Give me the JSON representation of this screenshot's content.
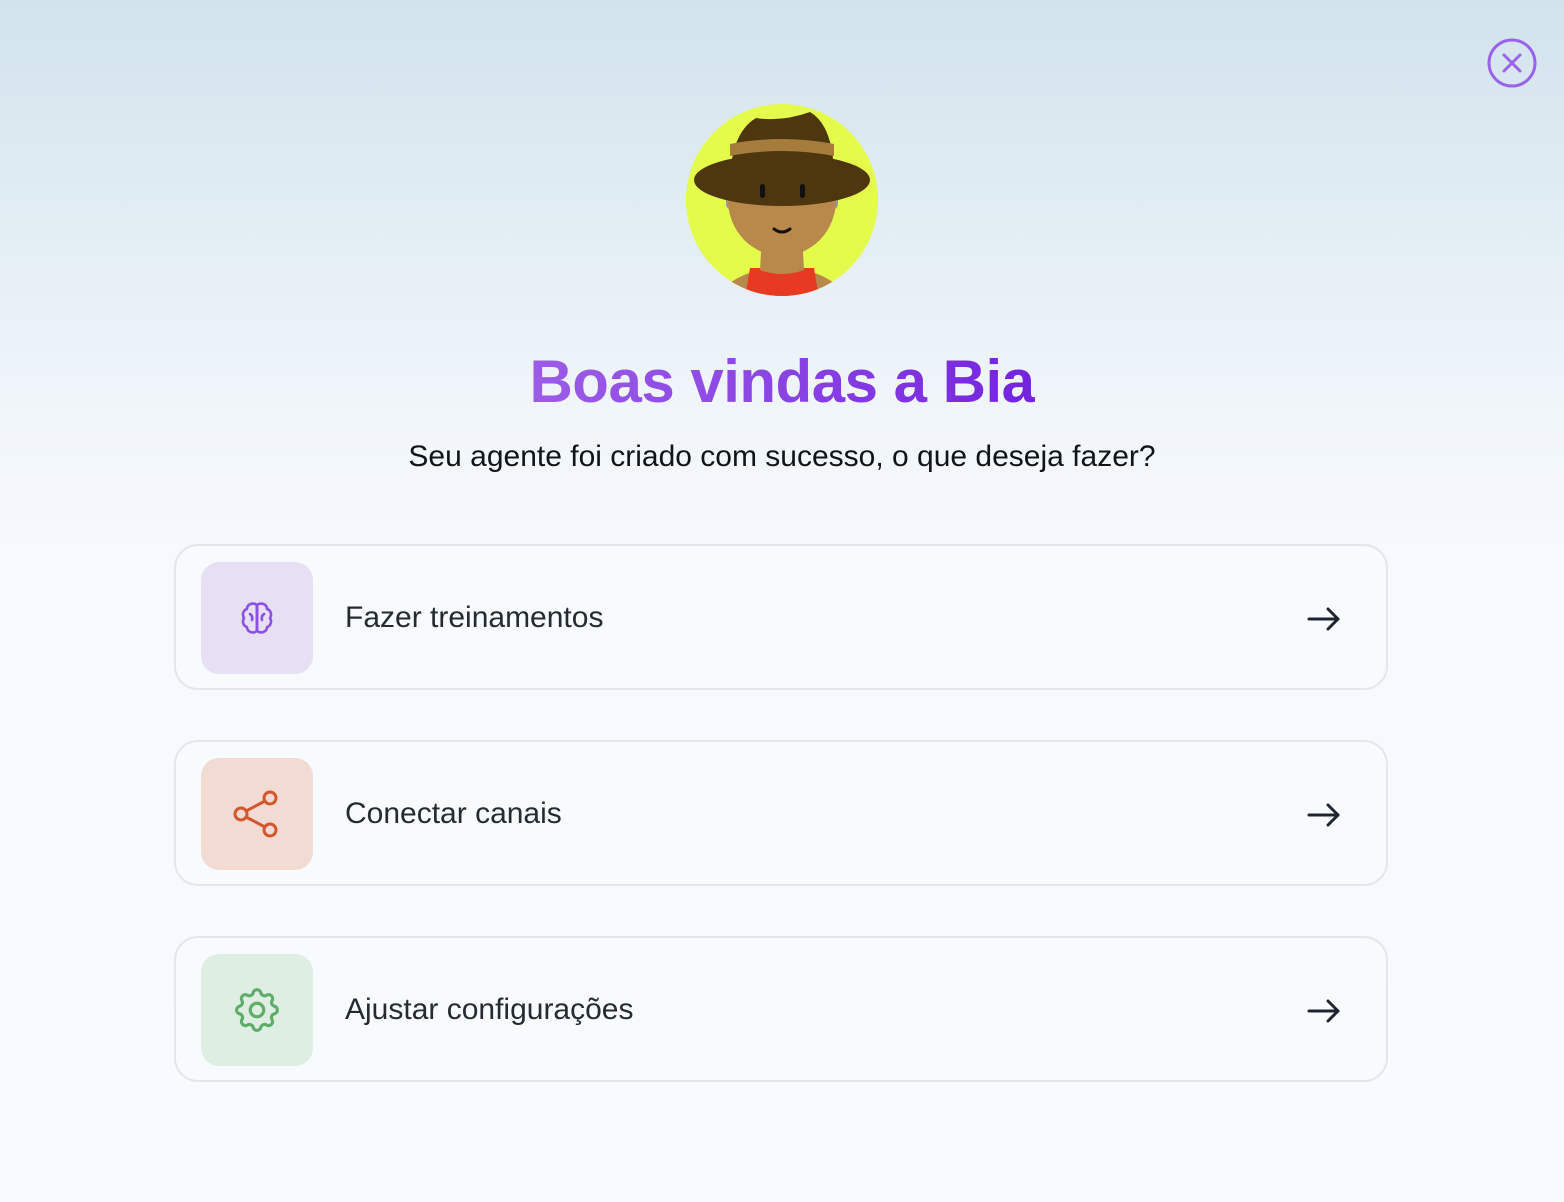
{
  "header": {
    "title": "Boas vindas a Bia",
    "subtitle": "Seu agente foi criado com sucesso, o que deseja fazer?",
    "close_icon": "close-circle-icon",
    "avatar": "farmer-avatar"
  },
  "options": [
    {
      "label": "Fazer treinamentos",
      "icon": "brain-icon",
      "icon_color": "#8b50e6",
      "icon_bg": "#e7dff4"
    },
    {
      "label": "Conectar canais",
      "icon": "share-icon",
      "icon_color": "#d2562e",
      "icon_bg": "#f2dbd3"
    },
    {
      "label": "Ajustar configurações",
      "icon": "gear-icon",
      "icon_color": "#5ead68",
      "icon_bg": "#dfeee3"
    }
  ],
  "colors": {
    "accent": "#7e3ae3",
    "close": "#9a63ea"
  }
}
